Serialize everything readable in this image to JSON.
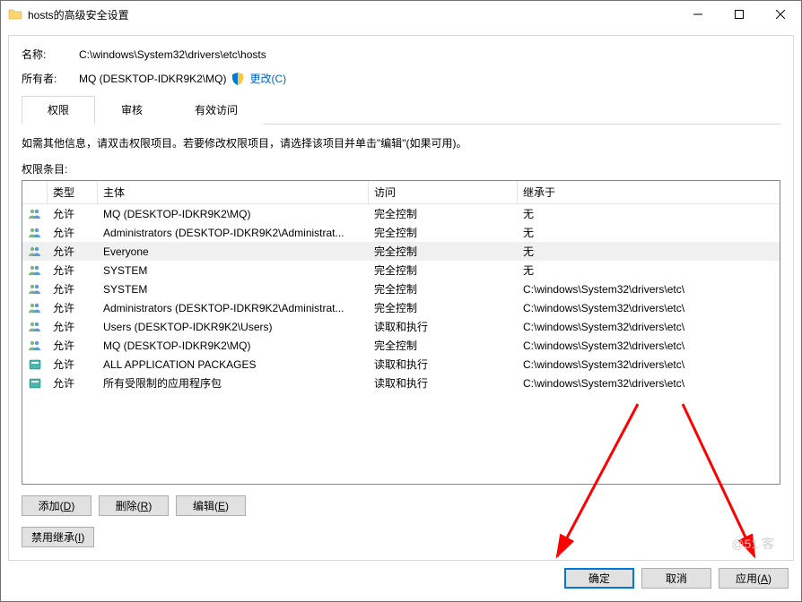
{
  "titlebar": {
    "title": "hosts的高级安全设置"
  },
  "info": {
    "name_label": "名称:",
    "name_value": "C:\\windows\\System32\\drivers\\etc\\hosts",
    "owner_label": "所有者:",
    "owner_value": "MQ (DESKTOP-IDKR9K2\\MQ)",
    "change_link": "更改(C)"
  },
  "tabs": {
    "permission": "权限",
    "audit": "审核",
    "effective": "有效访问"
  },
  "instruction": "如需其他信息，请双击权限项目。若要修改权限项目，请选择该项目并单击\"编辑\"(如果可用)。",
  "list_label": "权限条目:",
  "columns": {
    "type": "类型",
    "principal": "主体",
    "access": "访问",
    "inherit": "继承于"
  },
  "entries": [
    {
      "icon": "users",
      "type": "允许",
      "principal": "MQ (DESKTOP-IDKR9K2\\MQ)",
      "access": "完全控制",
      "inherit": "无"
    },
    {
      "icon": "users",
      "type": "允许",
      "principal": "Administrators (DESKTOP-IDKR9K2\\Administrat...",
      "access": "完全控制",
      "inherit": "无"
    },
    {
      "icon": "users",
      "type": "允许",
      "principal": "Everyone",
      "access": "完全控制",
      "inherit": "无",
      "selected": true
    },
    {
      "icon": "users",
      "type": "允许",
      "principal": "SYSTEM",
      "access": "完全控制",
      "inherit": "无"
    },
    {
      "icon": "users",
      "type": "允许",
      "principal": "SYSTEM",
      "access": "完全控制",
      "inherit": "C:\\windows\\System32\\drivers\\etc\\"
    },
    {
      "icon": "users",
      "type": "允许",
      "principal": "Administrators (DESKTOP-IDKR9K2\\Administrat...",
      "access": "完全控制",
      "inherit": "C:\\windows\\System32\\drivers\\etc\\"
    },
    {
      "icon": "users",
      "type": "允许",
      "principal": "Users (DESKTOP-IDKR9K2\\Users)",
      "access": "读取和执行",
      "inherit": "C:\\windows\\System32\\drivers\\etc\\"
    },
    {
      "icon": "users",
      "type": "允许",
      "principal": "MQ (DESKTOP-IDKR9K2\\MQ)",
      "access": "完全控制",
      "inherit": "C:\\windows\\System32\\drivers\\etc\\"
    },
    {
      "icon": "package",
      "type": "允许",
      "principal": "ALL APPLICATION PACKAGES",
      "access": "读取和执行",
      "inherit": "C:\\windows\\System32\\drivers\\etc\\"
    },
    {
      "icon": "package",
      "type": "允许",
      "principal": "所有受限制的应用程序包",
      "access": "读取和执行",
      "inherit": "C:\\windows\\System32\\drivers\\etc\\"
    }
  ],
  "buttons": {
    "add": "添加(D)",
    "remove": "删除(R)",
    "edit": "编辑(E)",
    "disable_inherit": "禁用继承(I)",
    "ok": "确定",
    "cancel": "取消",
    "apply": "应用(A)"
  },
  "watermark": "@51 客"
}
